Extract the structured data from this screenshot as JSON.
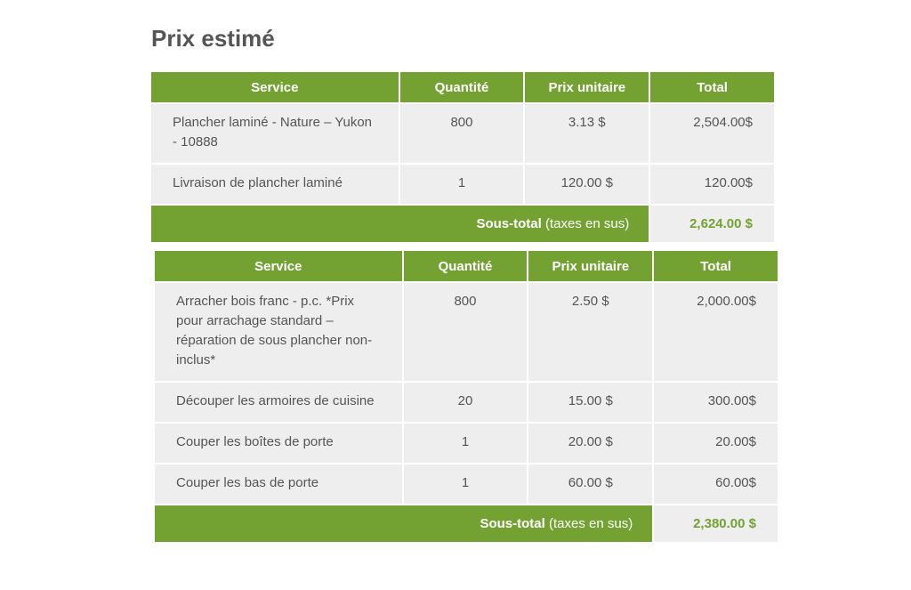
{
  "title": "Prix estimé",
  "tables": [
    {
      "headers": {
        "service": "Service",
        "quantity": "Quantité",
        "unit_price": "Prix unitaire",
        "total": "Total"
      },
      "rows": [
        {
          "service": "Plancher laminé - Nature – Yukon - 10888",
          "quantity": "800",
          "unit_price": "3.13 $",
          "total": "2,504.00$"
        },
        {
          "service": "Livraison de plancher laminé",
          "quantity": "1",
          "unit_price": "120.00 $",
          "total": "120.00$"
        }
      ],
      "subtotal": {
        "label": "Sous-total",
        "note": " (taxes en sus)",
        "value": "2,624.00 $"
      }
    },
    {
      "headers": {
        "service": "Service",
        "quantity": "Quantité",
        "unit_price": "Prix unitaire",
        "total": "Total"
      },
      "rows": [
        {
          "service": "Arracher bois franc - p.c. *Prix pour arrachage standard – réparation de sous plancher non-inclus*",
          "quantity": "800",
          "unit_price": "2.50 $",
          "total": "2,000.00$"
        },
        {
          "service": "Découper les armoires de cuisine",
          "quantity": "20",
          "unit_price": "15.00 $",
          "total": "300.00$"
        },
        {
          "service": "Couper les boîtes de porte",
          "quantity": "1",
          "unit_price": "20.00 $",
          "total": "20.00$"
        },
        {
          "service": "Couper les bas de porte",
          "quantity": "1",
          "unit_price": "60.00 $",
          "total": "60.00$"
        }
      ],
      "subtotal": {
        "label": "Sous-total",
        "note": " (taxes en sus)",
        "value": "2,380.00 $"
      }
    }
  ],
  "colors": {
    "accent": "#73a232",
    "cell_bg": "#eeeeee",
    "text": "#555555"
  }
}
